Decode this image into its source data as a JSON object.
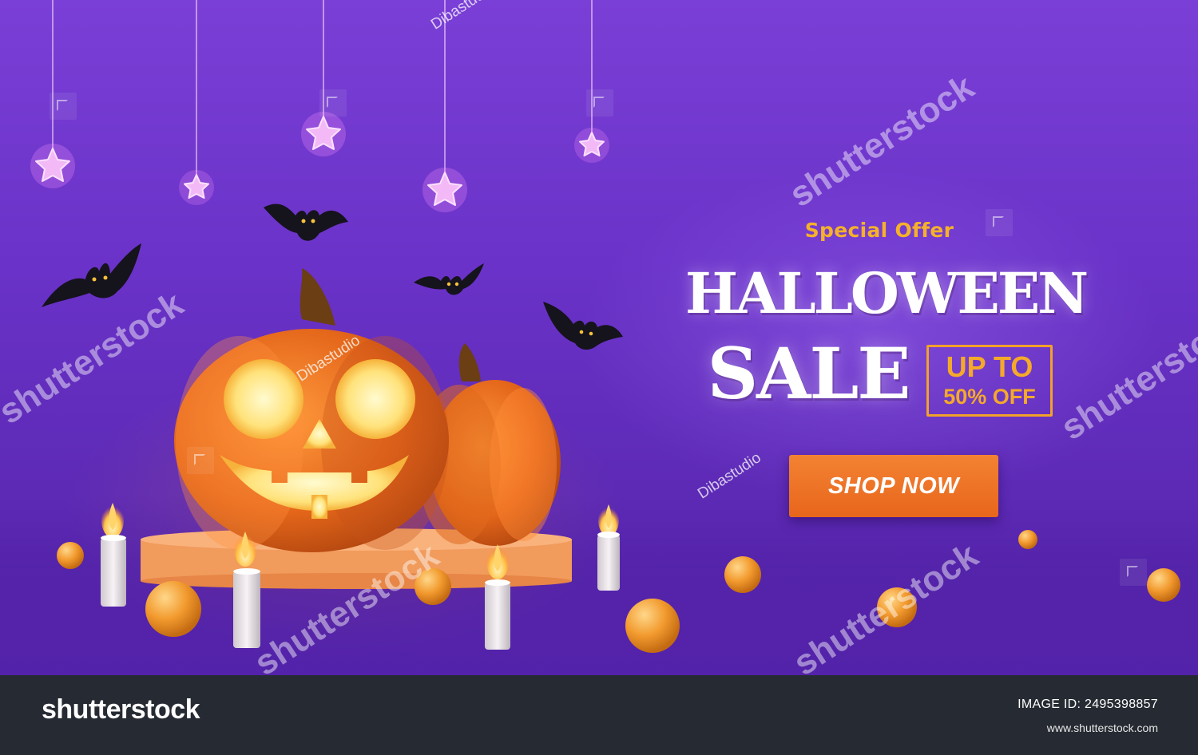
{
  "banner": {
    "special_offer": "Special Offer",
    "title_line1": "HALLOWEEN",
    "title_line2": "SALE",
    "promo_line1": "UP TO",
    "promo_line2": "50% OFF",
    "cta_label": "SHOP NOW"
  },
  "watermark": {
    "brand": "shutterstock",
    "author": "Dibastudio"
  },
  "footer": {
    "logo_text": "shutterstock",
    "image_id": "IMAGE ID: 2495398857",
    "url": "www.shutterstock.com"
  },
  "colors": {
    "background": "#6a32c8",
    "accent_orange": "#f38233",
    "promo_gold": "#f5a92a",
    "footer_bg": "#262b33"
  },
  "icons": [
    "star-ornament-icon",
    "bat-icon",
    "jack-o-lantern-icon",
    "pumpkin-icon",
    "candle-icon",
    "orb-icon",
    "shutterstock-watermark-icon"
  ]
}
